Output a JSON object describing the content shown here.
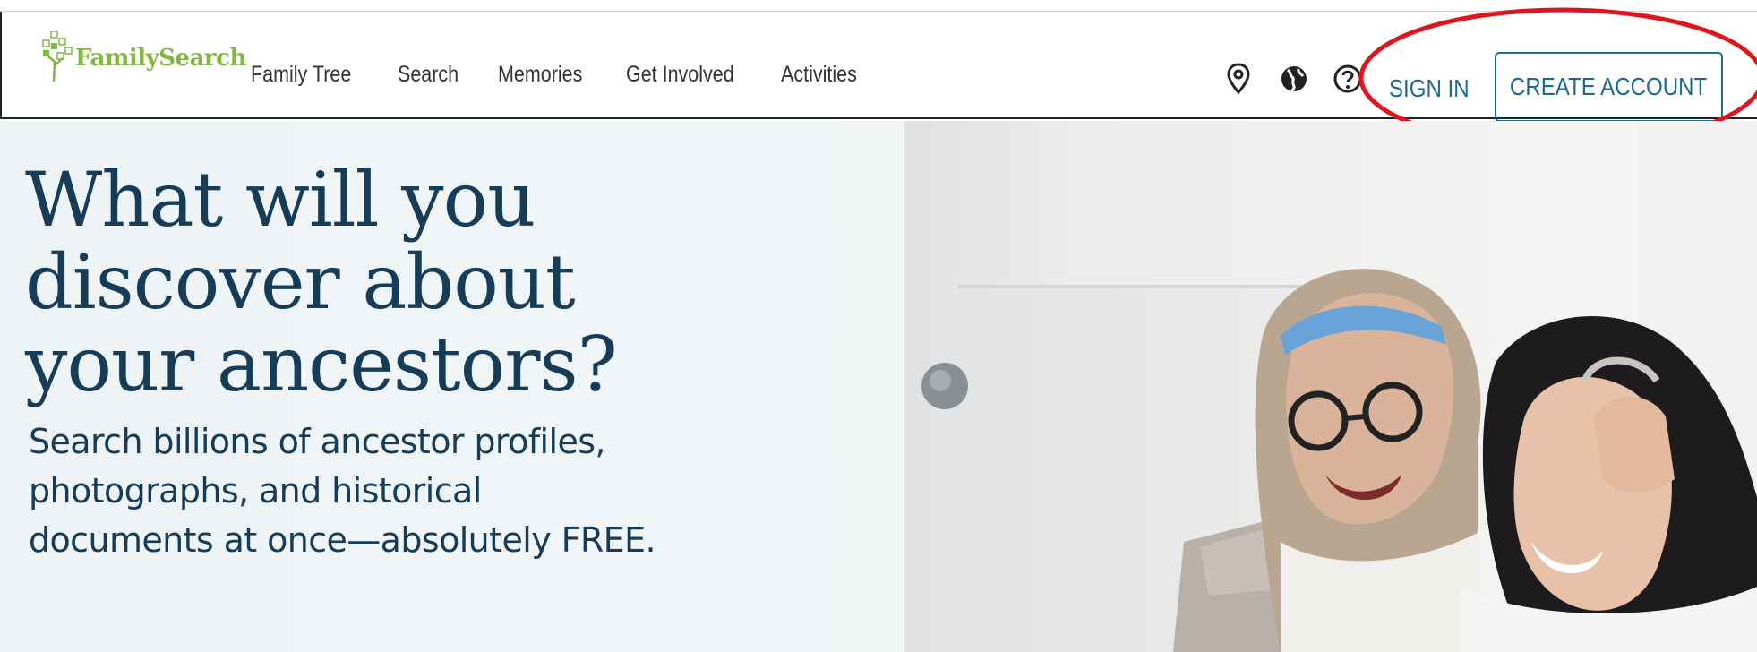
{
  "header": {
    "logo_text": "FamilySearch",
    "nav": [
      {
        "label": "Family Tree"
      },
      {
        "label": "Search"
      },
      {
        "label": "Memories"
      },
      {
        "label": "Get Involved"
      },
      {
        "label": "Activities"
      }
    ],
    "icons": [
      "location-pin-icon",
      "globe-icon",
      "help-icon"
    ],
    "sign_in_label": "SIGN IN",
    "create_account_label": "CREATE ACCOUNT"
  },
  "hero": {
    "headline_lines": [
      "What will you",
      "discover about",
      "your ancestors?"
    ],
    "subtext_lines": [
      "Search billions of ancestor profiles,",
      "photographs, and historical",
      "documents at once—absolutely FREE."
    ]
  },
  "colors": {
    "brand_green": "#80b842",
    "link_blue": "#1c6a8f",
    "headline_navy": "#173c57",
    "annotation_red": "#e0141e"
  }
}
